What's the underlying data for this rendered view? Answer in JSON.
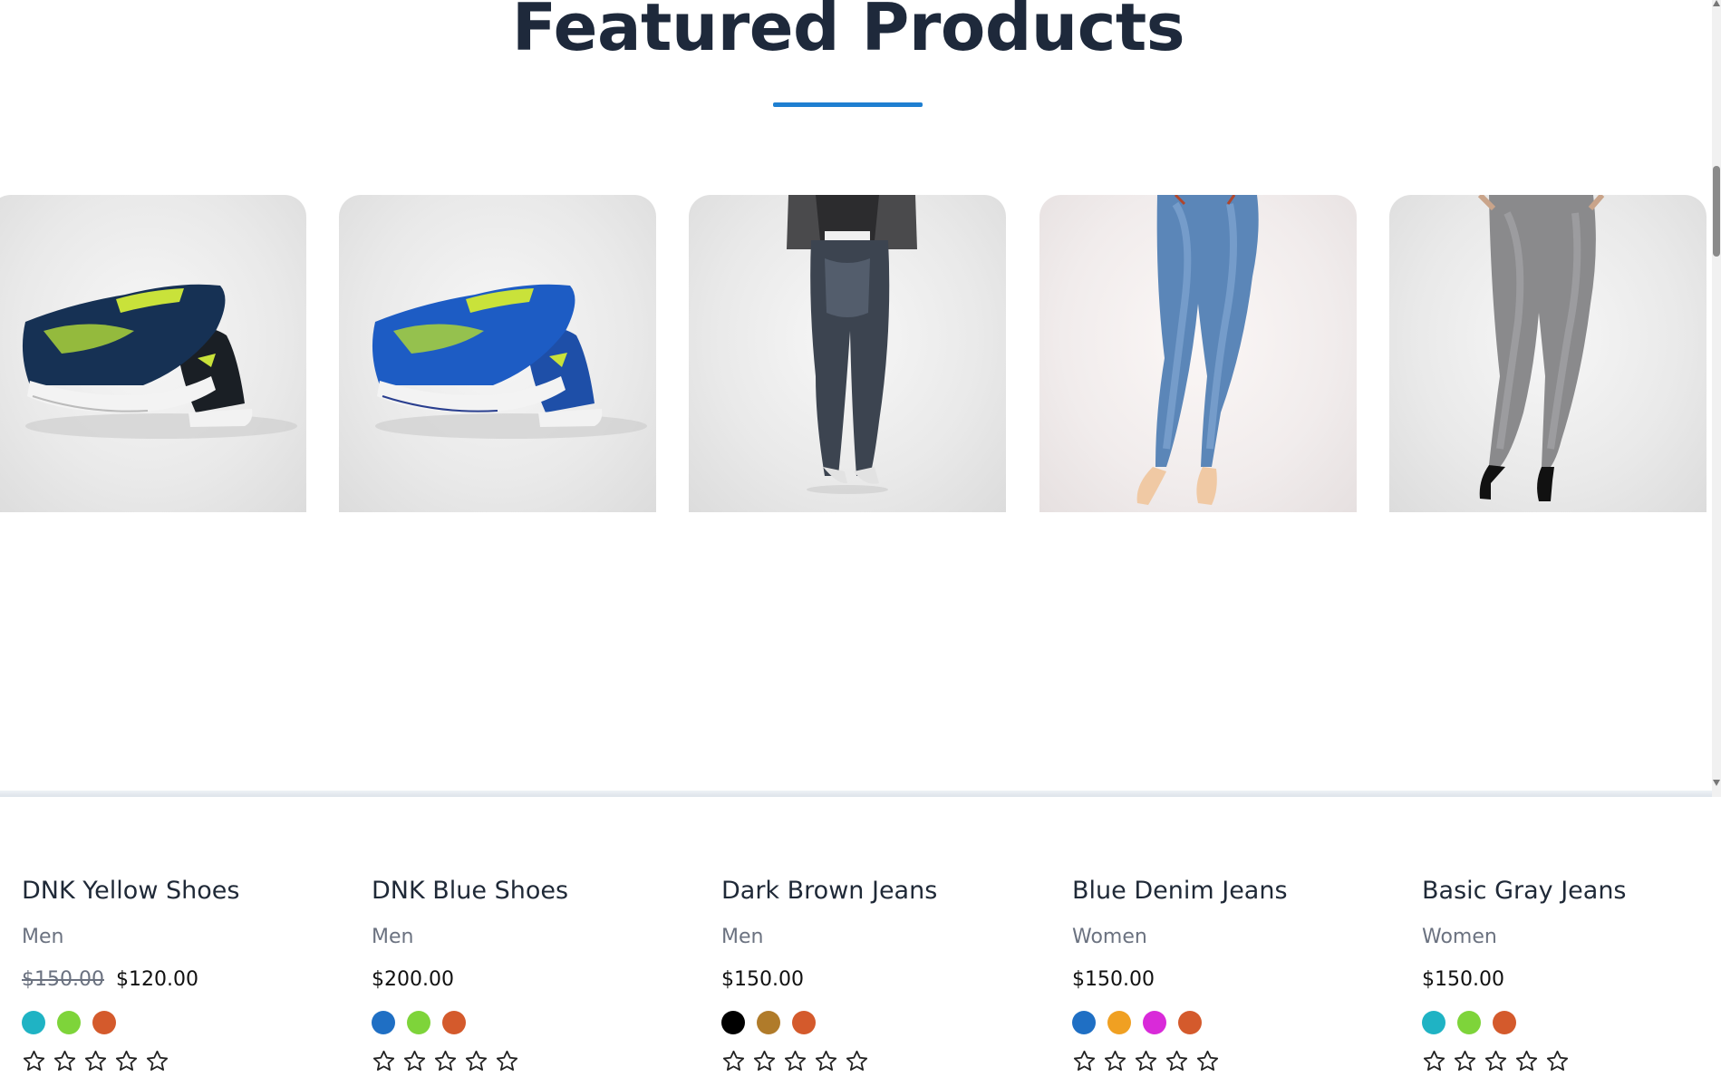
{
  "section": {
    "title": "Featured Products",
    "accent_color": "#1f7fd1"
  },
  "products": [
    {
      "name": "DNK Yellow Shoes",
      "category": "Men",
      "old_price": "$150.00",
      "price": "$120.00",
      "image_icon": "yellow-shoes-image",
      "colors": [
        "#1fb3c4",
        "#7ed43a",
        "#d45a2c"
      ],
      "rating": 0
    },
    {
      "name": "DNK Blue Shoes",
      "category": "Men",
      "price": "$200.00",
      "image_icon": "blue-shoes-image",
      "colors": [
        "#1f6fc4",
        "#7ed43a",
        "#d45a2c"
      ],
      "rating": 0
    },
    {
      "name": "Dark Brown Jeans",
      "category": "Men",
      "price": "$150.00",
      "image_icon": "dark-jeans-image",
      "colors": [
        "#000000",
        "#b07b2a",
        "#d45a2c"
      ],
      "rating": 0
    },
    {
      "name": "Blue Denim Jeans",
      "category": "Women",
      "price": "$150.00",
      "image_icon": "blue-denim-jeans-image",
      "colors": [
        "#1f6fc4",
        "#f0a022",
        "#d92ad9",
        "#d45a2c"
      ],
      "rating": 0
    },
    {
      "name": "Basic Gray Jeans",
      "category": "Women",
      "price": "$150.00",
      "image_icon": "gray-jeans-image",
      "colors": [
        "#1fb3c4",
        "#7ed43a",
        "#d45a2c"
      ],
      "rating": 0
    }
  ]
}
